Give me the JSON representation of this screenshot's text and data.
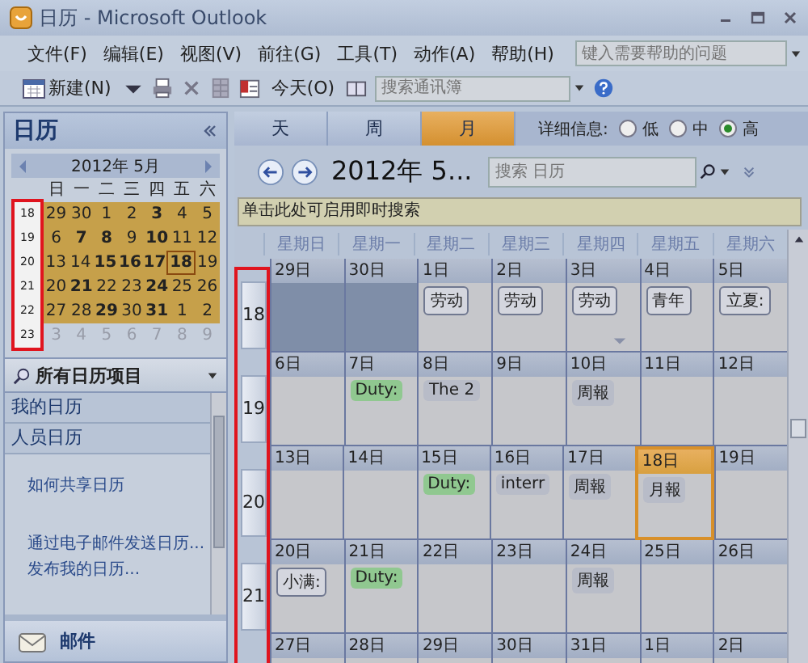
{
  "window": {
    "title": "日历 - Microsoft Outlook"
  },
  "menu": [
    "文件(F)",
    "编辑(E)",
    "视图(V)",
    "前往(G)",
    "工具(T)",
    "动作(A)",
    "帮助(H)"
  ],
  "help_box": {
    "placeholder": "键入需要帮助的问题"
  },
  "toolbar": {
    "new_button": "新建(N)",
    "today_button": "今天(O)",
    "search": {
      "placeholder": "搜索通讯簿"
    }
  },
  "sidebar": {
    "title": "日历",
    "mini_calendar": {
      "title": "2012年 5月",
      "marked": true,
      "weekdays": [
        "日",
        "一",
        "二",
        "三",
        "四",
        "五",
        "六"
      ],
      "weeks": [
        {
          "number": "18",
          "days": [
            {
              "label": "29",
              "bold": false,
              "muted": false,
              "selected": false
            },
            {
              "label": "30",
              "bold": false,
              "muted": false,
              "selected": false
            },
            {
              "label": "1",
              "bold": false,
              "muted": false,
              "selected": false
            },
            {
              "label": "2",
              "bold": false,
              "muted": false,
              "selected": false
            },
            {
              "label": "3",
              "bold": true,
              "muted": false,
              "selected": false
            },
            {
              "label": "4",
              "bold": false,
              "muted": false,
              "selected": false
            },
            {
              "label": "5",
              "bold": false,
              "muted": false,
              "selected": false
            }
          ]
        },
        {
          "number": "19",
          "days": [
            {
              "label": "6",
              "bold": false,
              "muted": false,
              "selected": false
            },
            {
              "label": "7",
              "bold": true,
              "muted": false,
              "selected": false
            },
            {
              "label": "8",
              "bold": true,
              "muted": false,
              "selected": false
            },
            {
              "label": "9",
              "bold": false,
              "muted": false,
              "selected": false
            },
            {
              "label": "10",
              "bold": true,
              "muted": false,
              "selected": false
            },
            {
              "label": "11",
              "bold": false,
              "muted": false,
              "selected": false
            },
            {
              "label": "12",
              "bold": false,
              "muted": false,
              "selected": false
            }
          ]
        },
        {
          "number": "20",
          "days": [
            {
              "label": "13",
              "bold": false,
              "muted": false,
              "selected": false
            },
            {
              "label": "14",
              "bold": false,
              "muted": false,
              "selected": false
            },
            {
              "label": "15",
              "bold": true,
              "muted": false,
              "selected": false
            },
            {
              "label": "16",
              "bold": true,
              "muted": false,
              "selected": false
            },
            {
              "label": "17",
              "bold": true,
              "muted": false,
              "selected": false
            },
            {
              "label": "18",
              "bold": true,
              "muted": false,
              "selected": true
            },
            {
              "label": "19",
              "bold": false,
              "muted": false,
              "selected": false
            }
          ]
        },
        {
          "number": "21",
          "days": [
            {
              "label": "20",
              "bold": false,
              "muted": false,
              "selected": false
            },
            {
              "label": "21",
              "bold": true,
              "muted": false,
              "selected": false
            },
            {
              "label": "22",
              "bold": false,
              "muted": false,
              "selected": false
            },
            {
              "label": "23",
              "bold": false,
              "muted": false,
              "selected": false
            },
            {
              "label": "24",
              "bold": true,
              "muted": false,
              "selected": false
            },
            {
              "label": "25",
              "bold": false,
              "muted": false,
              "selected": false
            },
            {
              "label": "26",
              "bold": false,
              "muted": false,
              "selected": false
            }
          ]
        },
        {
          "number": "22",
          "days": [
            {
              "label": "27",
              "bold": false,
              "muted": false,
              "selected": false
            },
            {
              "label": "28",
              "bold": false,
              "muted": false,
              "selected": false
            },
            {
              "label": "29",
              "bold": true,
              "muted": false,
              "selected": false
            },
            {
              "label": "30",
              "bold": false,
              "muted": false,
              "selected": false
            },
            {
              "label": "31",
              "bold": true,
              "muted": false,
              "selected": false
            },
            {
              "label": "1",
              "bold": false,
              "muted": false,
              "selected": false
            },
            {
              "label": "2",
              "bold": false,
              "muted": false,
              "selected": false
            }
          ]
        },
        {
          "number": "23",
          "days": [
            {
              "label": "3",
              "bold": false,
              "muted": true,
              "selected": false
            },
            {
              "label": "4",
              "bold": false,
              "muted": true,
              "selected": false
            },
            {
              "label": "5",
              "bold": false,
              "muted": true,
              "selected": false
            },
            {
              "label": "6",
              "bold": false,
              "muted": true,
              "selected": false
            },
            {
              "label": "7",
              "bold": false,
              "muted": true,
              "selected": false
            },
            {
              "label": "8",
              "bold": false,
              "muted": true,
              "selected": false
            },
            {
              "label": "9",
              "bold": false,
              "muted": true,
              "selected": false
            }
          ]
        }
      ]
    },
    "all_items": "所有日历项目",
    "sections": [
      "我的日历",
      "人员日历"
    ],
    "links": [
      "如何共享日历",
      "通过电子邮件发送日历...",
      "发布我的日历..."
    ],
    "nav_button": "邮件"
  },
  "view_tabs": [
    {
      "label": "天",
      "selected": false
    },
    {
      "label": "周",
      "selected": false
    },
    {
      "label": "月",
      "selected": true
    }
  ],
  "detail": {
    "label": "详细信息:",
    "options": [
      {
        "label": "低",
        "selected": false
      },
      {
        "label": "中",
        "selected": false
      },
      {
        "label": "高",
        "selected": true
      }
    ]
  },
  "header": {
    "title": "2012年 5...",
    "search": {
      "placeholder": "搜索 日历"
    }
  },
  "instant_search_bar": "单击此处可启用即时搜索",
  "month": {
    "marked": true,
    "weekdays": [
      "星期日",
      "星期一",
      "星期二",
      "星期三",
      "星期四",
      "星期五",
      "星期六"
    ],
    "weeks": [
      {
        "number": "18",
        "days": [
          {
            "label": "29日",
            "outside": true,
            "today": false
          },
          {
            "label": "30日",
            "outside": true,
            "today": false
          },
          {
            "label": "1日",
            "outside": false,
            "today": false,
            "event": {
              "text": "劳动",
              "kind": "holiday"
            }
          },
          {
            "label": "2日",
            "outside": false,
            "today": false,
            "event": {
              "text": "劳动",
              "kind": "holiday"
            }
          },
          {
            "label": "3日",
            "outside": false,
            "today": false,
            "more": true,
            "event": {
              "text": "劳动",
              "kind": "holiday"
            }
          },
          {
            "label": "4日",
            "outside": false,
            "today": false,
            "event": {
              "text": "青年",
              "kind": "holiday"
            }
          },
          {
            "label": "5日",
            "outside": false,
            "today": false,
            "event": {
              "text": "立夏:",
              "kind": "holiday"
            }
          }
        ]
      },
      {
        "number": "19",
        "days": [
          {
            "label": "6日",
            "outside": false,
            "today": false
          },
          {
            "label": "7日",
            "outside": false,
            "today": false,
            "event": {
              "text": "Duty:",
              "kind": "duty"
            }
          },
          {
            "label": "8日",
            "outside": false,
            "today": false,
            "event": {
              "text": "The 2",
              "kind": "plain"
            }
          },
          {
            "label": "9日",
            "outside": false,
            "today": false
          },
          {
            "label": "10日",
            "outside": false,
            "today": false,
            "event": {
              "text": "周報",
              "kind": "plain"
            }
          },
          {
            "label": "11日",
            "outside": false,
            "today": false
          },
          {
            "label": "12日",
            "outside": false,
            "today": false
          }
        ]
      },
      {
        "number": "20",
        "days": [
          {
            "label": "13日",
            "outside": false,
            "today": false
          },
          {
            "label": "14日",
            "outside": false,
            "today": false
          },
          {
            "label": "15日",
            "outside": false,
            "today": false,
            "event": {
              "text": "Duty:",
              "kind": "duty"
            }
          },
          {
            "label": "16日",
            "outside": false,
            "today": false,
            "event": {
              "text": "interr",
              "kind": "plain"
            }
          },
          {
            "label": "17日",
            "outside": false,
            "today": false,
            "event": {
              "text": "周報",
              "kind": "plain"
            }
          },
          {
            "label": "18日",
            "outside": false,
            "today": true,
            "event": {
              "text": "月報",
              "kind": "plain"
            }
          },
          {
            "label": "19日",
            "outside": false,
            "today": false
          }
        ]
      },
      {
        "number": "21",
        "days": [
          {
            "label": "20日",
            "outside": false,
            "today": false,
            "event": {
              "text": "小满:",
              "kind": "holiday"
            }
          },
          {
            "label": "21日",
            "outside": false,
            "today": false,
            "event": {
              "text": "Duty:",
              "kind": "duty"
            }
          },
          {
            "label": "22日",
            "outside": false,
            "today": false
          },
          {
            "label": "23日",
            "outside": false,
            "today": false
          },
          {
            "label": "24日",
            "outside": false,
            "today": false,
            "event": {
              "text": "周報",
              "kind": "plain"
            }
          },
          {
            "label": "25日",
            "outside": false,
            "today": false
          },
          {
            "label": "26日",
            "outside": false,
            "today": false
          }
        ]
      },
      {
        "days": [
          {
            "label": "27日",
            "outside": false,
            "today": false
          },
          {
            "label": "28日",
            "outside": false,
            "today": false
          },
          {
            "label": "29日",
            "outside": false,
            "today": false
          },
          {
            "label": "30日",
            "outside": false,
            "today": false
          },
          {
            "label": "31日",
            "outside": false,
            "today": false
          },
          {
            "label": "1日",
            "outside": false,
            "today": false
          },
          {
            "label": "2日",
            "outside": false,
            "today": false
          }
        ]
      }
    ]
  }
}
